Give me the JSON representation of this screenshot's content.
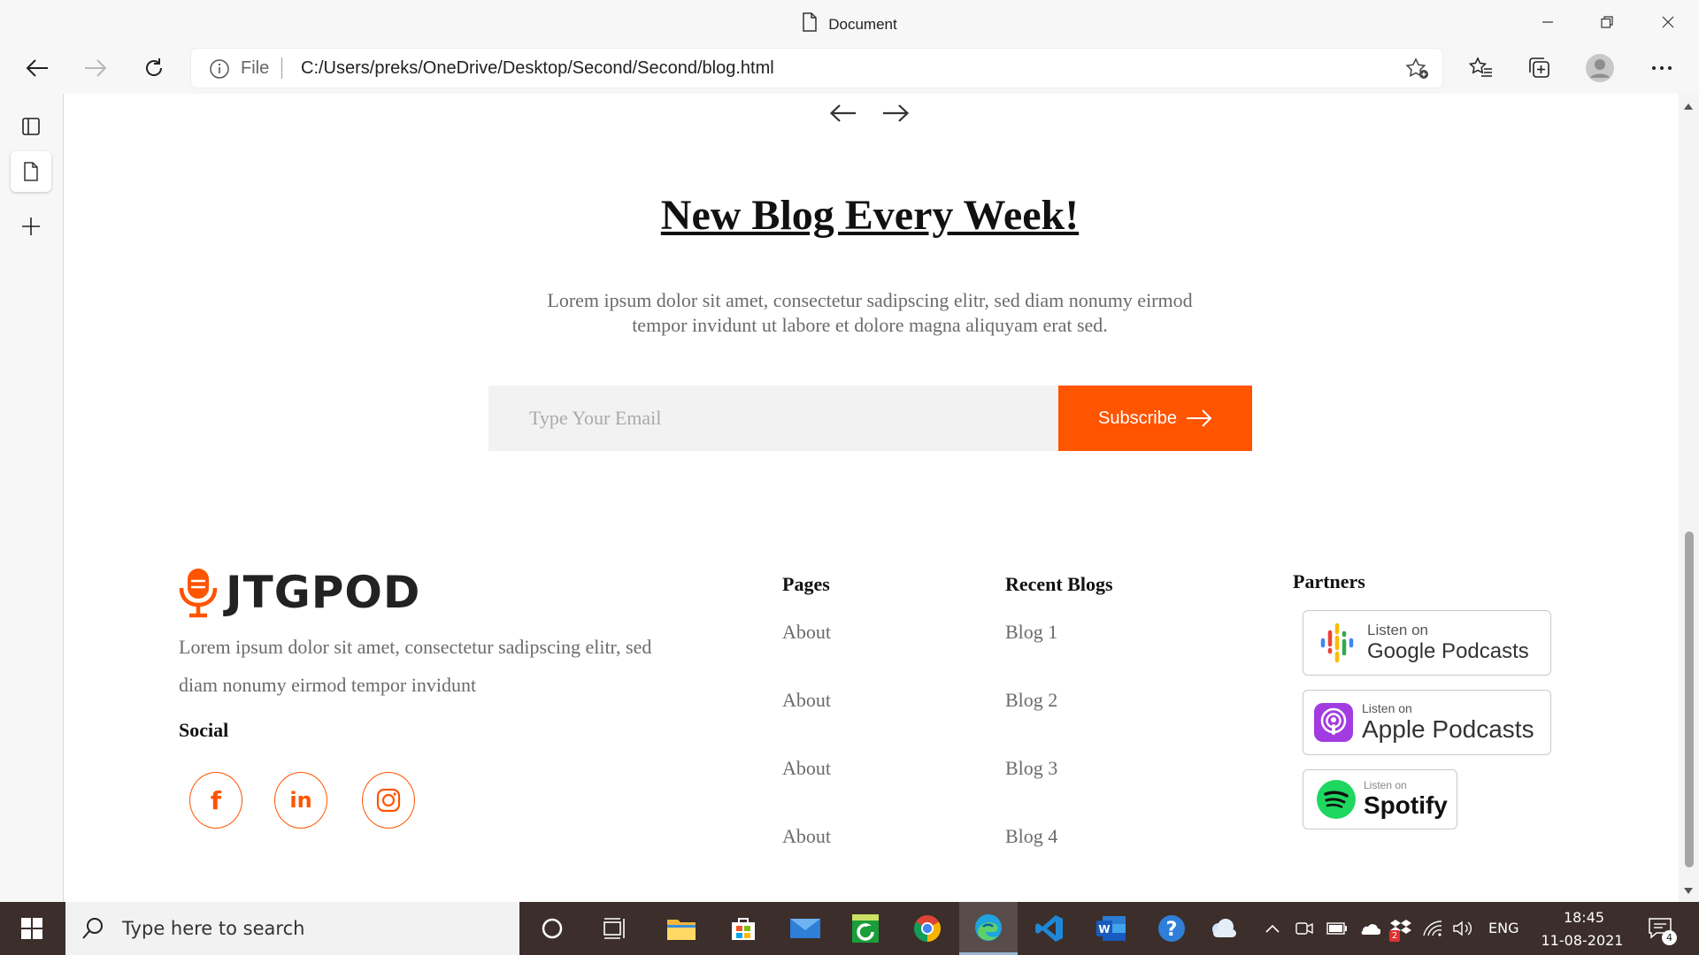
{
  "window": {
    "title": "Document"
  },
  "toolbar": {
    "file_label": "File",
    "url": "C:/Users/preks/OneDrive/Desktop/Second/Second/blog.html"
  },
  "page": {
    "newsletter": {
      "title": "New Blog Every Week!",
      "text": "Lorem ipsum dolor sit amet, consectetur sadipscing elitr, sed diam nonumy eirmod tempor invidunt ut labore et dolore magna aliquyam erat sed.",
      "email_placeholder": "Type Your Email",
      "subscribe_label": "Subscribe"
    },
    "footer": {
      "brand": "JTGPOD",
      "about": "Lorem ipsum dolor sit amet, consectetur sadipscing elitr, sed diam nonumy eirmod tempor invidunt",
      "social_heading": "Social",
      "social": [
        {
          "glyph": "f",
          "icon": "facebook-icon"
        },
        {
          "glyph": "in",
          "icon": "linkedin-icon"
        },
        {
          "icon": "instagram-icon"
        }
      ],
      "pages_heading": "Pages",
      "pages_links": [
        "About",
        "About",
        "About",
        "About"
      ],
      "blogs_heading": "Recent Blogs",
      "blog_links": [
        "Blog 1",
        "Blog 2",
        "Blog 3",
        "Blog 4"
      ],
      "partners_heading": "Partners",
      "partners": [
        {
          "small": "Listen on",
          "big": "Google Podcasts",
          "icon": "google-podcasts-icon"
        },
        {
          "small": "Listen on",
          "big": "Apple Podcasts",
          "icon": "apple-podcasts-icon"
        },
        {
          "small": "Listen on",
          "big": "Spotify",
          "icon": "spotify-icon"
        }
      ]
    }
  },
  "taskbar": {
    "search_placeholder": "Type here to search",
    "language": "ENG",
    "time": "18:45",
    "date": "11-08-2021",
    "notification_count": "4",
    "dropbox_badge": "2"
  },
  "colors": {
    "accent": "#ff5400",
    "taskbar": "#3b2e2b",
    "chrome": "#f7f7f7"
  }
}
